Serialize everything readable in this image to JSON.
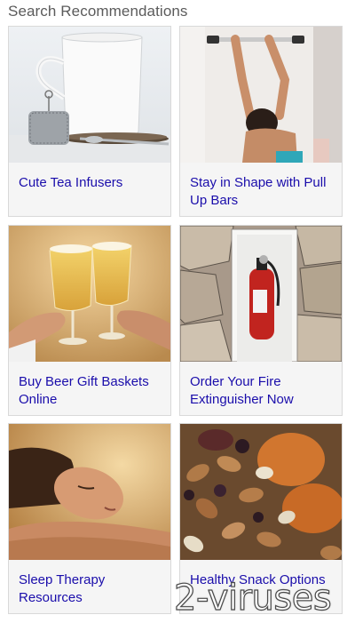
{
  "header": {
    "title": "Search Recommendations"
  },
  "cards": [
    {
      "label": "Cute Tea Infusers",
      "image": "tea-infuser-photo"
    },
    {
      "label": "Stay in Shape with Pull Up Bars",
      "image": "pull-up-bar-photo"
    },
    {
      "label": "Buy Beer Gift Baskets Online",
      "image": "beer-glasses-photo"
    },
    {
      "label": "Order Your Fire Extinguisher Now",
      "image": "fire-extinguisher-photo"
    },
    {
      "label": "Sleep Therapy Resources",
      "image": "sleeping-woman-photo"
    },
    {
      "label": "Healthy Snack Options",
      "image": "nuts-and-dried-fruit-photo"
    }
  ],
  "watermark": {
    "text": "2-viruses"
  },
  "colors": {
    "link": "#1a0dab",
    "card_bg": "#f5f5f5",
    "card_border": "#d9d9d9",
    "header_text": "#5b5b5b"
  }
}
